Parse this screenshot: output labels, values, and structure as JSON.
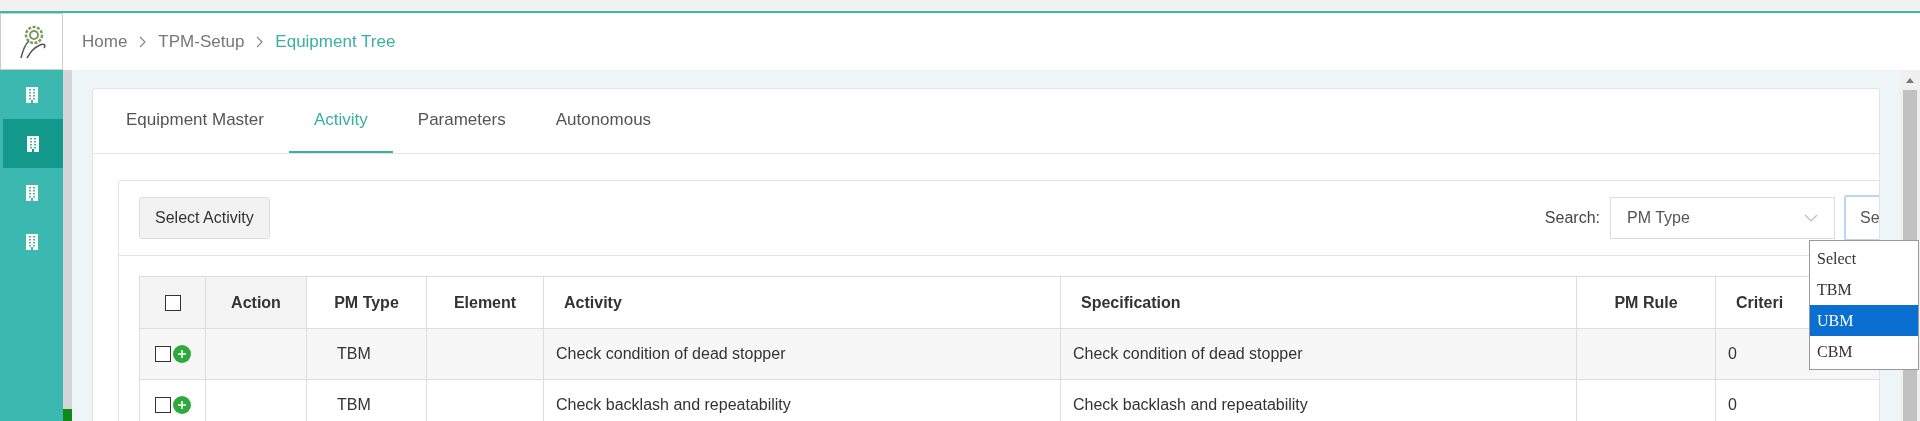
{
  "sidebar": {
    "items": [
      {
        "selected": false
      },
      {
        "selected": true
      },
      {
        "selected": false
      },
      {
        "selected": false
      }
    ]
  },
  "breadcrumb": [
    {
      "label": "Home",
      "current": false
    },
    {
      "label": "TPM-Setup",
      "current": false
    },
    {
      "label": "Equipment Tree",
      "current": true
    }
  ],
  "tabs": [
    {
      "label": "Equipment Master",
      "selected": false
    },
    {
      "label": "Activity",
      "selected": true
    },
    {
      "label": "Parameters",
      "selected": false
    },
    {
      "label": "Autonomous",
      "selected": false
    }
  ],
  "toolbar": {
    "button": "Select Activity",
    "search_label": "Search:",
    "search_field": "PM Type",
    "value_field": "Se"
  },
  "dropdown": [
    {
      "label": "Select",
      "selected": false
    },
    {
      "label": "TBM",
      "selected": false
    },
    {
      "label": "UBM",
      "selected": true
    },
    {
      "label": "CBM",
      "selected": false
    }
  ],
  "table": {
    "header_checked": false,
    "columns": [
      "Action",
      "PM Type",
      "Element",
      "Activity",
      "Specification",
      "PM Rule",
      "Criteri"
    ],
    "rows": [
      {
        "checked": false,
        "cells": [
          "",
          "TBM",
          "",
          "Check condition of dead stopper",
          "Check condition of dead stopper",
          "",
          "0"
        ]
      },
      {
        "checked": false,
        "cells": [
          "",
          "TBM",
          "",
          "Check backlash and repeatability",
          "Check backlash and repeatability",
          "",
          "0"
        ]
      }
    ]
  }
}
